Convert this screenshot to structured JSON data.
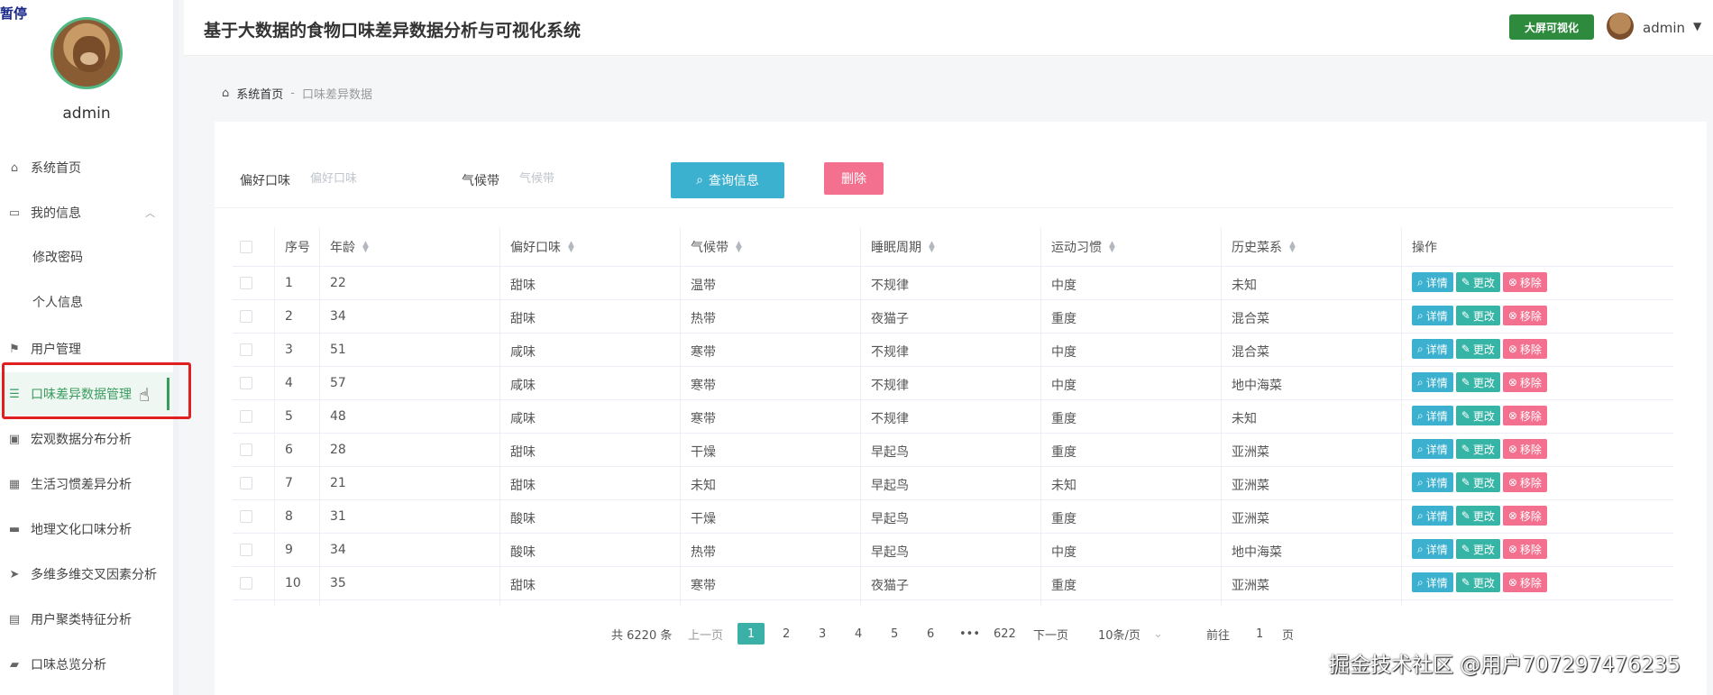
{
  "overlay": {
    "pause_label": "暂停"
  },
  "sidebar": {
    "username": "admin",
    "items": [
      {
        "label": "系统首页"
      },
      {
        "label": "我的信息"
      },
      {
        "label": "修改密码"
      },
      {
        "label": "个人信息"
      },
      {
        "label": "用户管理"
      },
      {
        "label": "口味差异数据管理"
      },
      {
        "label": "宏观数据分布分析"
      },
      {
        "label": "生活习惯差异分析"
      },
      {
        "label": "地理文化口味分析"
      },
      {
        "label": "多维多维交叉因素分析"
      },
      {
        "label": "用户聚类特征分析"
      },
      {
        "label": "口味总览分析"
      }
    ]
  },
  "header": {
    "title": "基于大数据的食物口味差异数据分析与可视化系统",
    "bigscreen_label": "大屏可视化",
    "user": "admin"
  },
  "breadcrumb": {
    "home": "系统首页",
    "sep": "-",
    "current": "口味差异数据"
  },
  "filters": {
    "taste_label": "偏好口味",
    "taste_placeholder": "偏好口味",
    "climate_label": "气候带",
    "climate_placeholder": "气候带",
    "search_label": "查询信息",
    "delete_label": "删除"
  },
  "table": {
    "headers": {
      "index": "序号",
      "age": "年龄",
      "taste": "偏好口味",
      "climate": "气候带",
      "sleep": "睡眠周期",
      "exercise": "运动习惯",
      "cuisine": "历史菜系",
      "ops": "操作"
    },
    "op_labels": {
      "detail": "详情",
      "edit": "更改",
      "remove": "移除"
    },
    "rows": [
      {
        "index": "1",
        "age": "22",
        "taste": "甜味",
        "climate": "温带",
        "sleep": "不规律",
        "exercise": "中度",
        "cuisine": "未知"
      },
      {
        "index": "2",
        "age": "34",
        "taste": "甜味",
        "climate": "热带",
        "sleep": "夜猫子",
        "exercise": "重度",
        "cuisine": "混合菜"
      },
      {
        "index": "3",
        "age": "51",
        "taste": "咸味",
        "climate": "寒带",
        "sleep": "不规律",
        "exercise": "中度",
        "cuisine": "混合菜"
      },
      {
        "index": "4",
        "age": "57",
        "taste": "咸味",
        "climate": "寒带",
        "sleep": "不规律",
        "exercise": "中度",
        "cuisine": "地中海菜"
      },
      {
        "index": "5",
        "age": "48",
        "taste": "咸味",
        "climate": "寒带",
        "sleep": "不规律",
        "exercise": "重度",
        "cuisine": "未知"
      },
      {
        "index": "6",
        "age": "28",
        "taste": "甜味",
        "climate": "干燥",
        "sleep": "早起鸟",
        "exercise": "重度",
        "cuisine": "亚洲菜"
      },
      {
        "index": "7",
        "age": "21",
        "taste": "甜味",
        "climate": "未知",
        "sleep": "早起鸟",
        "exercise": "未知",
        "cuisine": "亚洲菜"
      },
      {
        "index": "8",
        "age": "31",
        "taste": "酸味",
        "climate": "干燥",
        "sleep": "早起鸟",
        "exercise": "重度",
        "cuisine": "亚洲菜"
      },
      {
        "index": "9",
        "age": "34",
        "taste": "酸味",
        "climate": "热带",
        "sleep": "早起鸟",
        "exercise": "中度",
        "cuisine": "地中海菜"
      },
      {
        "index": "10",
        "age": "35",
        "taste": "甜味",
        "climate": "寒带",
        "sleep": "夜猫子",
        "exercise": "重度",
        "cuisine": "亚洲菜"
      }
    ]
  },
  "pagination": {
    "total": "共 6220 条",
    "prev": "上一页",
    "pages": [
      "1",
      "2",
      "3",
      "4",
      "5",
      "6"
    ],
    "ellipsis": "•••",
    "last": "622",
    "next": "下一页",
    "page_size": "10条/页",
    "goto_label": "前往",
    "goto_value": "1",
    "goto_suffix": "页"
  },
  "watermark": "掘金技术社区 @用户707297476235"
}
